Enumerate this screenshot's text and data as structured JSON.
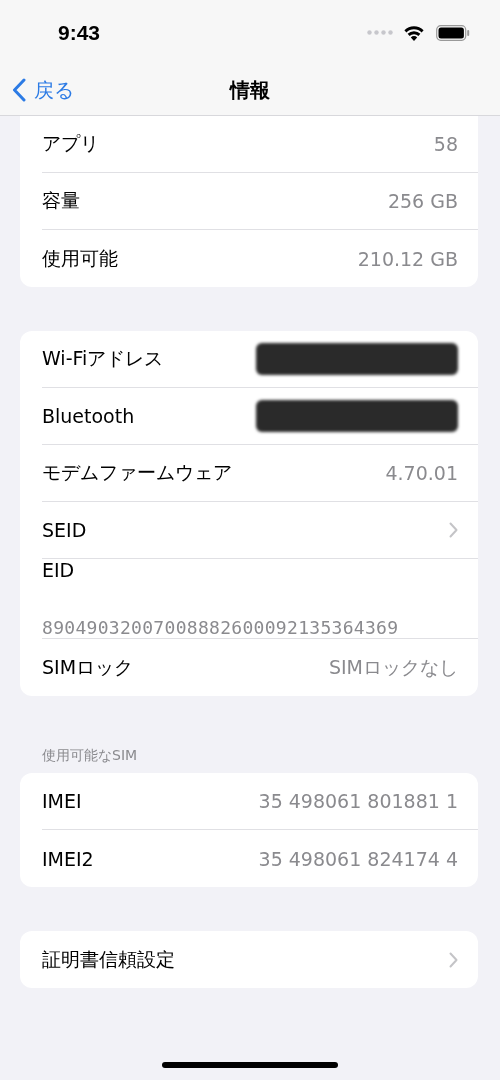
{
  "status_bar": {
    "time": "9:43"
  },
  "nav": {
    "back": "戻る",
    "title": "情報"
  },
  "groups": [
    {
      "rows": [
        {
          "kind": "value",
          "label": "アプリ",
          "value": "58"
        },
        {
          "kind": "value",
          "label": "容量",
          "value": "256 GB"
        },
        {
          "kind": "value",
          "label": "使用可能",
          "value": "210.12 GB"
        }
      ]
    },
    {
      "rows": [
        {
          "kind": "redacted",
          "label": "Wi-Fiアドレス"
        },
        {
          "kind": "redacted",
          "label": "Bluetooth"
        },
        {
          "kind": "value",
          "label": "モデムファームウェア",
          "value": "4.70.01"
        },
        {
          "kind": "chevron",
          "label": "SEID"
        },
        {
          "kind": "stacked",
          "label": "EID",
          "value": "89049032007008882600092135364369"
        },
        {
          "kind": "value",
          "label": "SIMロック",
          "value": "SIMロックなし"
        }
      ]
    },
    {
      "header": "使用可能なSIM",
      "rows": [
        {
          "kind": "value",
          "label": "IMEI",
          "value": "35 498061 801881 1"
        },
        {
          "kind": "value",
          "label": "IMEI2",
          "value": "35 498061 824174 4"
        }
      ]
    },
    {
      "rows": [
        {
          "kind": "chevron",
          "label": "証明書信頼設定"
        }
      ]
    }
  ]
}
